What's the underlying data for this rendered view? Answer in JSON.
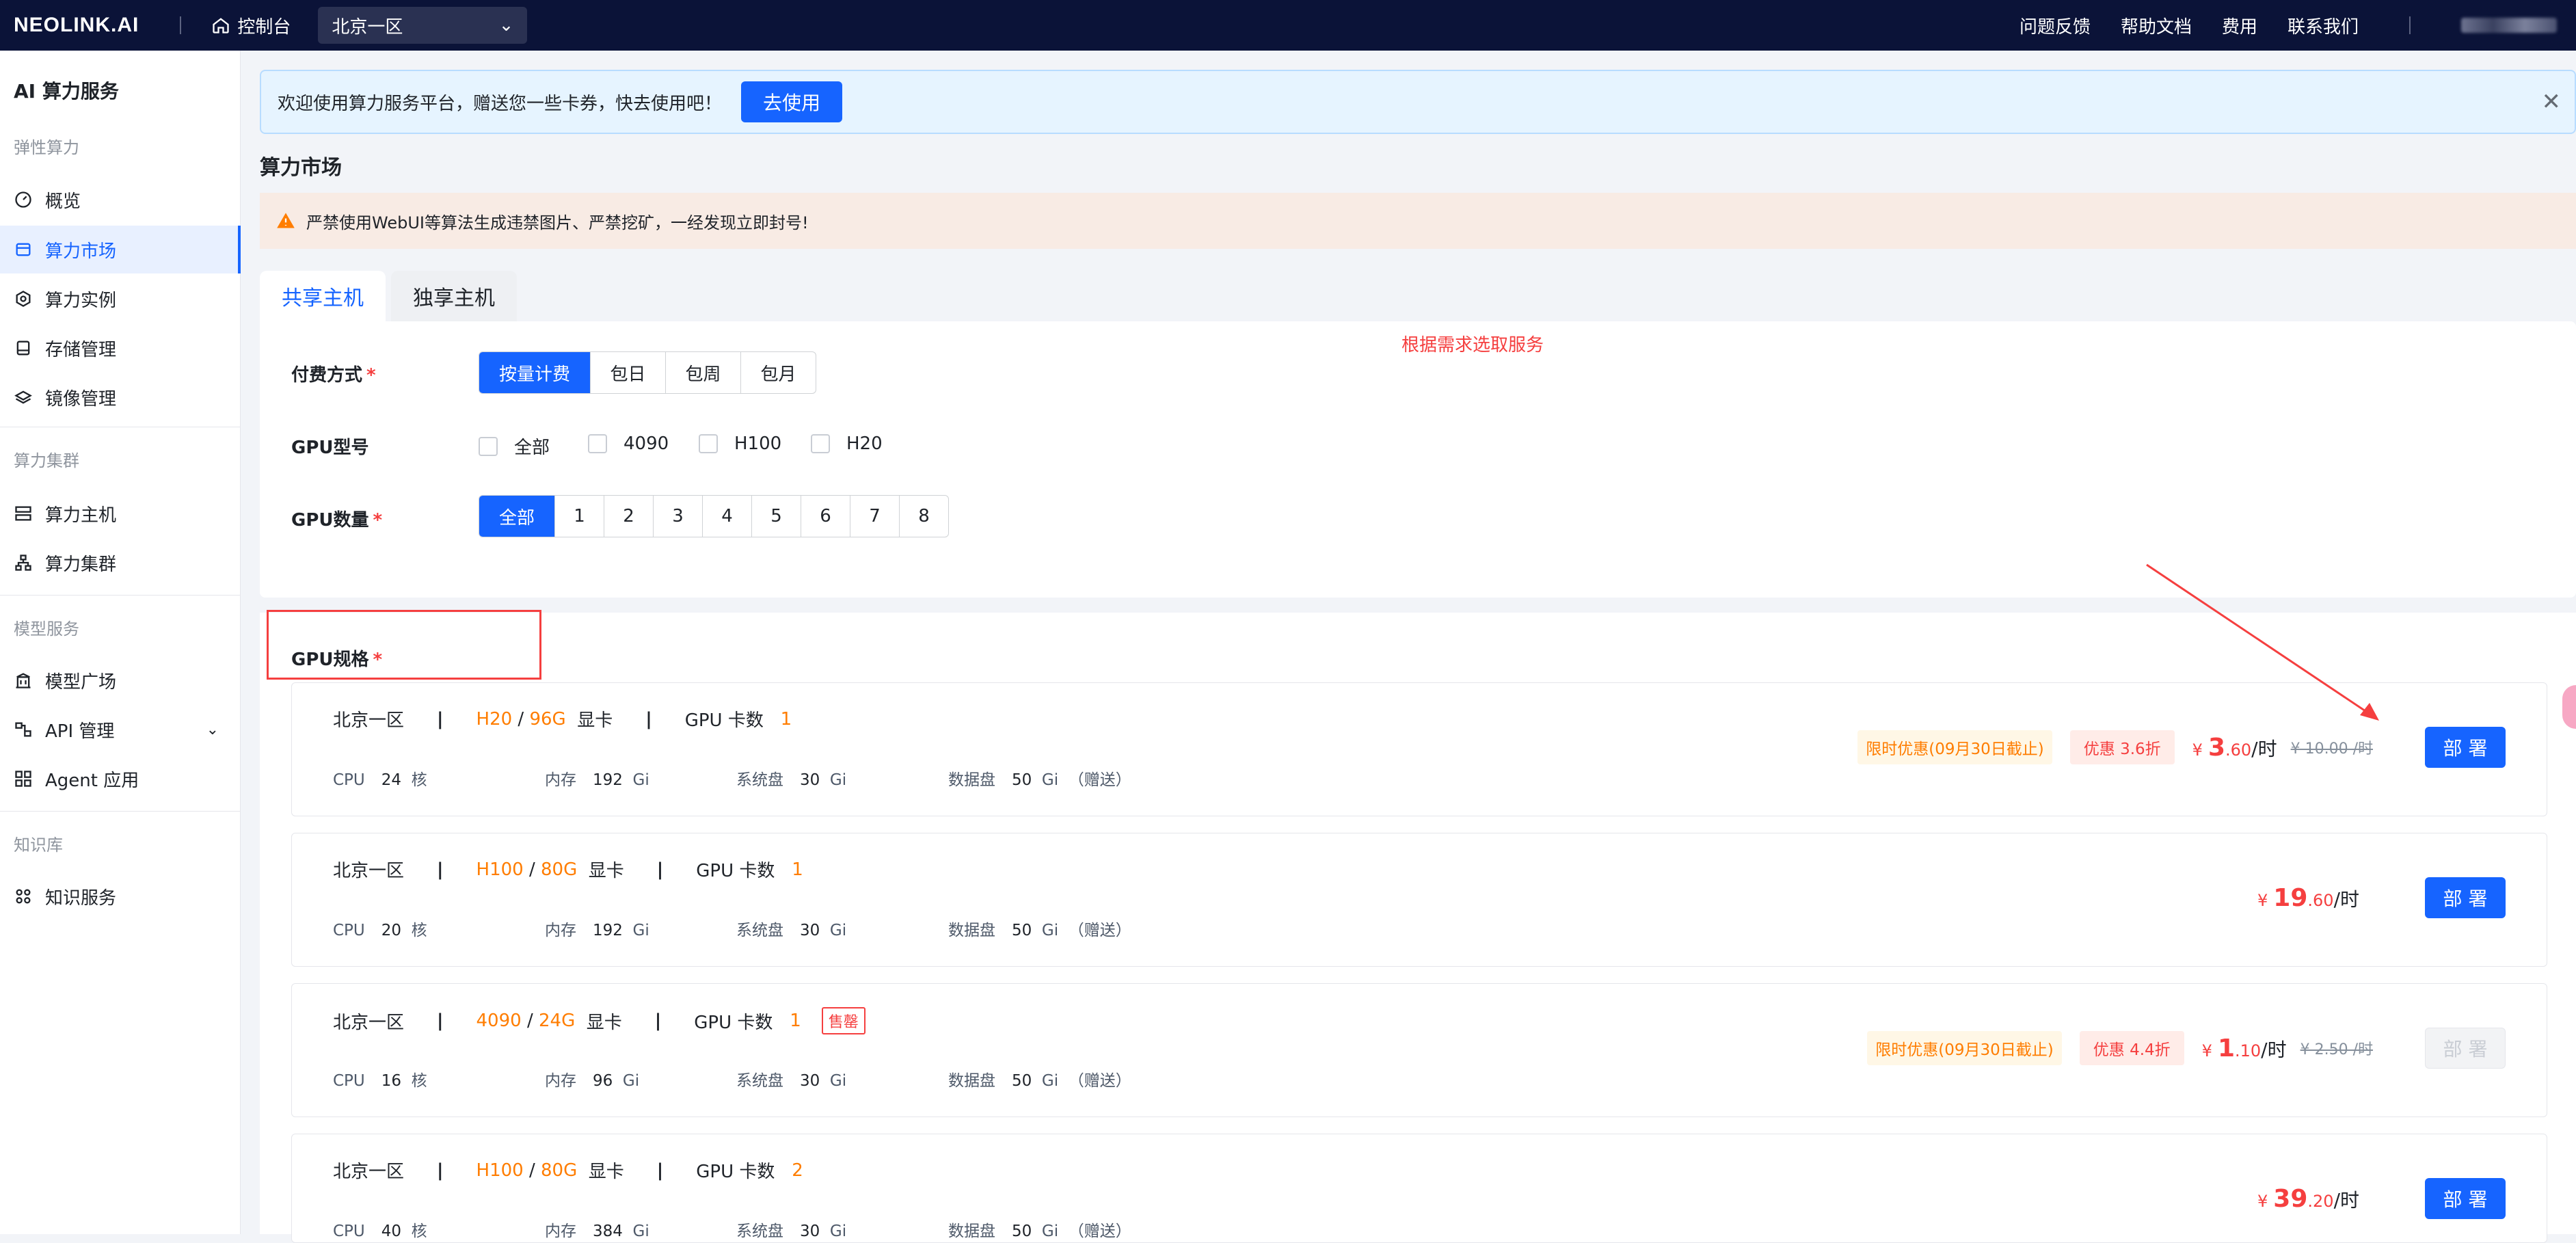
{
  "topbar": {
    "logo": "NEOLINK.AI",
    "home_label": "控制台",
    "region": "北京一区",
    "links": [
      "问题反馈",
      "帮助文档",
      "费用",
      "联系我们"
    ]
  },
  "sidebar": {
    "title": "AI 算力服务",
    "groups": [
      "弹性算力",
      "算力集群",
      "模型服务",
      "知识库"
    ],
    "items": [
      "概览",
      "算力市场",
      "算力实例",
      "存储管理",
      "镜像管理",
      "算力主机",
      "算力集群",
      "模型广场",
      "API 管理",
      "Agent 应用",
      "知识服务"
    ]
  },
  "banner": {
    "text": "欢迎使用算力服务平台，赠送您一些卡券，快去使用吧！",
    "button": "去使用"
  },
  "page_title": "算力市场",
  "warning": "严禁使用WebUI等算法生成违禁图片、严禁挖矿，一经发现立即封号!",
  "tabs": [
    "共享主机",
    "独享主机"
  ],
  "hint": "根据需求选取服务",
  "filters": {
    "billing_label": "付费方式",
    "billing_options": [
      "按量计费",
      "包日",
      "包周",
      "包月"
    ],
    "gpu_model_label": "GPU型号",
    "gpu_models": [
      "全部",
      "4090",
      "H100",
      "H20"
    ],
    "gpu_count_label": "GPU数量",
    "gpu_counts": [
      "全部",
      "1",
      "2",
      "3",
      "4",
      "5",
      "6",
      "7",
      "8"
    ],
    "spec_label": "GPU规格",
    "required_mark": "*"
  },
  "labels": {
    "gpu_card": "显卡",
    "gpu_card_count": "GPU 卡数",
    "cpu": "CPU",
    "mem": "内存",
    "sysdisk": "系统盘",
    "datadisk": "数据盘",
    "core": "核",
    "gi": "Gi",
    "gift": "（赠送）",
    "per_hour": "/时",
    "yen": "¥",
    "deploy": "部 署",
    "sold_out": "售罄"
  },
  "cards": [
    {
      "region": "北京一区",
      "gpu": "H20",
      "vram": "96G",
      "count": "1",
      "cpu": "24",
      "mem": "192",
      "sys": "30",
      "data": "50",
      "promo": "限时优惠(09月30日截止)",
      "discount": "优惠 3.6折",
      "price_int": "3",
      "price_dec": ".60",
      "orig": "¥ 10.00 /时",
      "sold_out": false,
      "gift": true
    },
    {
      "region": "北京一区",
      "gpu": "H100",
      "vram": "80G",
      "count": "1",
      "cpu": "20",
      "mem": "192",
      "sys": "30",
      "data": "50",
      "promo": "",
      "discount": "",
      "price_int": "19",
      "price_dec": ".60",
      "orig": "",
      "sold_out": false,
      "gift": true
    },
    {
      "region": "北京一区",
      "gpu": "4090",
      "vram": "24G",
      "count": "1",
      "cpu": "16",
      "mem": "96",
      "sys": "30",
      "data": "50",
      "promo": "限时优惠(09月30日截止)",
      "discount": "优惠 4.4折",
      "price_int": "1",
      "price_dec": ".10",
      "orig": "¥ 2.50 /时",
      "sold_out": true,
      "gift": true
    },
    {
      "region": "北京一区",
      "gpu": "H100",
      "vram": "80G",
      "count": "2",
      "cpu": "40",
      "mem": "384",
      "sys": "30",
      "data": "50",
      "promo": "",
      "discount": "",
      "price_int": "39",
      "price_dec": ".20",
      "orig": "",
      "sold_out": false,
      "gift": true
    }
  ],
  "colors": {
    "primary": "#1664ff",
    "accent": "#ff7d00",
    "danger": "#f53f3f",
    "nav": "#0b1338"
  }
}
